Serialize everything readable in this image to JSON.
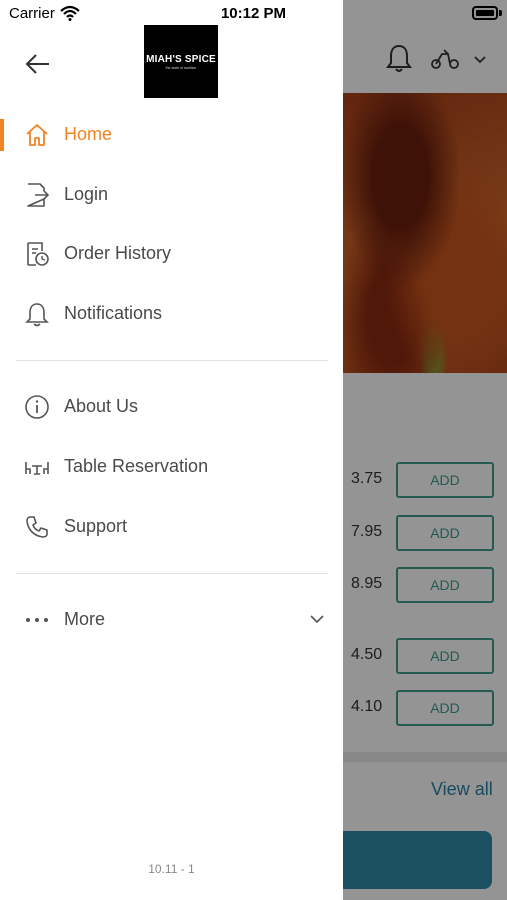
{
  "status_bar": {
    "carrier": "Carrier",
    "time": "10:12 PM"
  },
  "drawer": {
    "logo_text": "MIAH'S SPICE",
    "logo_tagline": "the taste of tradition",
    "menu_primary": [
      {
        "label": "Home",
        "icon": "home-icon",
        "active": true
      },
      {
        "label": "Login",
        "icon": "login-icon",
        "active": false
      },
      {
        "label": "Order History",
        "icon": "order-history-icon",
        "active": false
      },
      {
        "label": "Notifications",
        "icon": "bell-icon",
        "active": false
      }
    ],
    "menu_secondary": [
      {
        "label": "About Us",
        "icon": "info-icon"
      },
      {
        "label": "Table Reservation",
        "icon": "table-icon"
      },
      {
        "label": "Support",
        "icon": "phone-icon"
      }
    ],
    "more_label": "More",
    "version": "10.11 - 1"
  },
  "background": {
    "prices": [
      "3.75",
      "7.95",
      "8.95",
      "4.50",
      "4.10"
    ],
    "add_label": "ADD",
    "view_all": "View all"
  },
  "colors": {
    "accent": "#f28322",
    "teal": "#3f9c8a",
    "link": "#2b7fa8"
  }
}
